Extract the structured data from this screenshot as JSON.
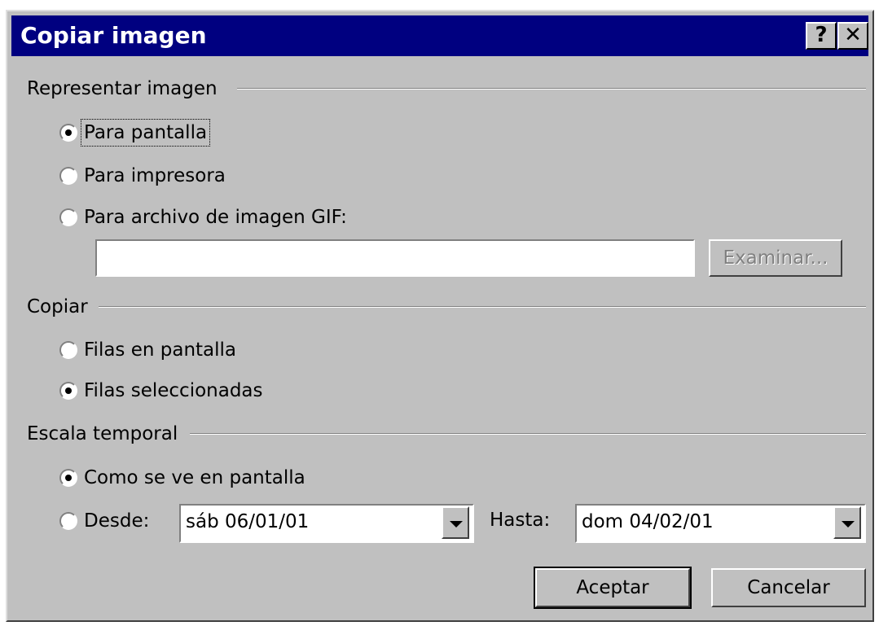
{
  "window": {
    "title": "Copiar imagen",
    "help_label": "?",
    "close_label": "✕"
  },
  "represent": {
    "legend": "Representar imagen",
    "options": [
      {
        "label": "Para pantalla",
        "selected": true
      },
      {
        "label": "Para impresora",
        "selected": false
      },
      {
        "label": "Para archivo de imagen GIF:",
        "selected": false
      }
    ],
    "file_path": "",
    "browse_label": "Examinar..."
  },
  "copy": {
    "legend": "Copiar",
    "options": [
      {
        "label": "Filas en pantalla",
        "selected": false
      },
      {
        "label": "Filas seleccionadas",
        "selected": true
      }
    ]
  },
  "timescale": {
    "legend": "Escala temporal",
    "options": [
      {
        "label": "Como se ve en pantalla",
        "selected": true
      },
      {
        "label": "Desde:",
        "selected": false
      }
    ],
    "from_value": "sáb 06/01/01",
    "to_label": "Hasta:",
    "to_value": "dom 04/02/01"
  },
  "buttons": {
    "ok_label": "Aceptar",
    "cancel_label": "Cancelar"
  }
}
